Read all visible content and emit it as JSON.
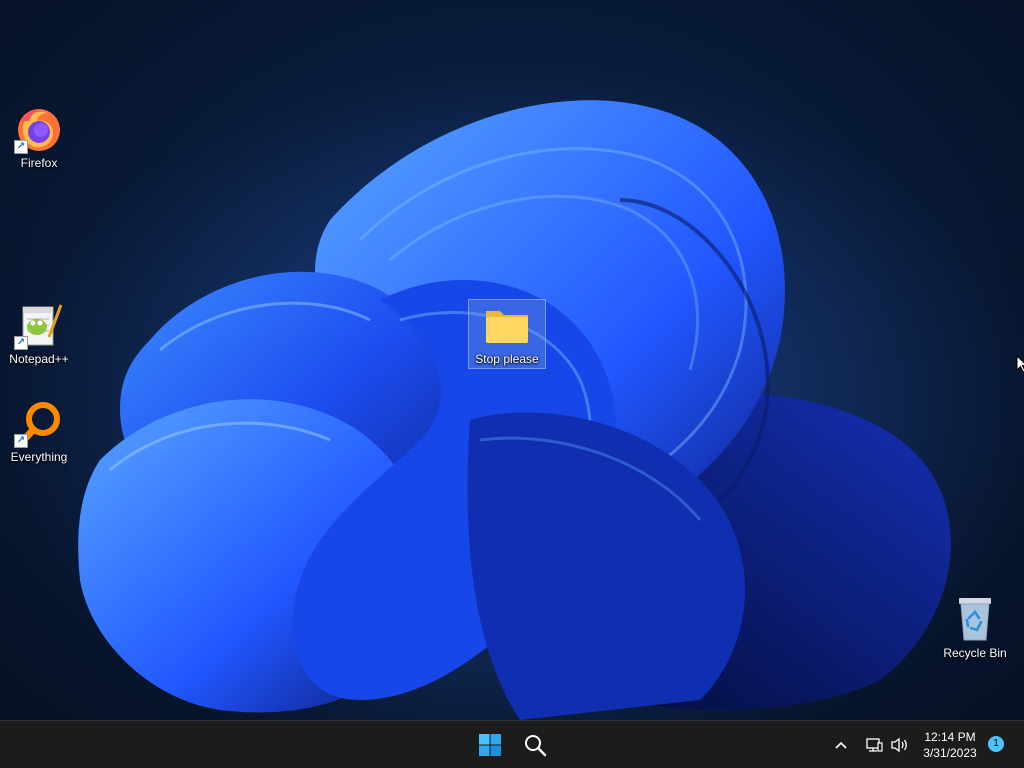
{
  "desktop": {
    "icons": [
      {
        "label": "Firefox",
        "shortcut": true
      },
      {
        "label": "Notepad++",
        "shortcut": true
      },
      {
        "label": "Everything",
        "shortcut": true
      },
      {
        "label": "Stop please",
        "shortcut": false,
        "selected": true
      },
      {
        "label": "Recycle Bin",
        "shortcut": false
      }
    ]
  },
  "taskbar": {
    "start_icon": "windows-logo-icon",
    "search_icon": "search-icon",
    "tray": {
      "overflow_icon": "chevron-up-icon",
      "network_icon": "network-icon",
      "volume_icon": "volume-icon"
    },
    "clock": {
      "time": "12:14 PM",
      "date": "3/31/2023"
    },
    "notification_count": "1"
  },
  "colors": {
    "accent": "#4cc2ff",
    "taskbar_bg": "#1c1c1c",
    "bloom_blue": "#1f5cff"
  }
}
